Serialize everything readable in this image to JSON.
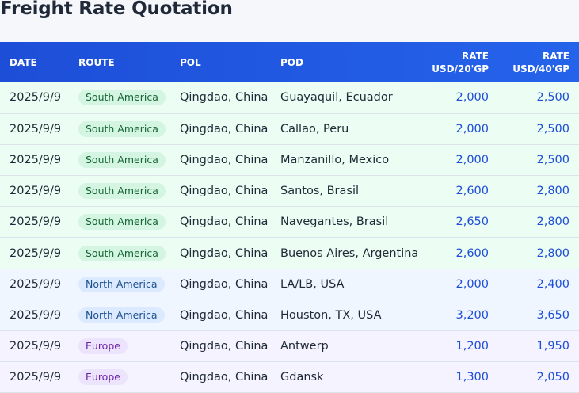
{
  "page": {
    "title": "Freight Rate Quotation"
  },
  "table": {
    "columns": {
      "date": "DATE",
      "route": "ROUTE",
      "pol": "POL",
      "pod": "POD",
      "rate20_line1": "RATE",
      "rate20_line2": "USD/20'GP",
      "rate40_line1": "RATE",
      "rate40_line2": "USD/40'GP"
    },
    "rows": [
      {
        "date": "2025/9/9",
        "route": "South America",
        "pol": "Qingdao, China",
        "pod": "Guayaquil, Ecuador",
        "rate20": "2,000",
        "rate40": "2,500"
      },
      {
        "date": "2025/9/9",
        "route": "South America",
        "pol": "Qingdao, China",
        "pod": "Callao, Peru",
        "rate20": "2,000",
        "rate40": "2,500"
      },
      {
        "date": "2025/9/9",
        "route": "South America",
        "pol": "Qingdao, China",
        "pod": "Manzanillo, Mexico",
        "rate20": "2,000",
        "rate40": "2,500"
      },
      {
        "date": "2025/9/9",
        "route": "South America",
        "pol": "Qingdao, China",
        "pod": "Santos, Brasil",
        "rate20": "2,600",
        "rate40": "2,800"
      },
      {
        "date": "2025/9/9",
        "route": "South America",
        "pol": "Qingdao, China",
        "pod": "Navegantes, Brasil",
        "rate20": "2,650",
        "rate40": "2,800"
      },
      {
        "date": "2025/9/9",
        "route": "South America",
        "pol": "Qingdao, China",
        "pod": "Buenos Aires, Argentina",
        "rate20": "2,600",
        "rate40": "2,800"
      },
      {
        "date": "2025/9/9",
        "route": "North America",
        "pol": "Qingdao, China",
        "pod": "LA/LB, USA",
        "rate20": "2,000",
        "rate40": "2,400"
      },
      {
        "date": "2025/9/9",
        "route": "North America",
        "pol": "Qingdao, China",
        "pod": "Houston, TX, USA",
        "rate20": "3,200",
        "rate40": "3,650"
      },
      {
        "date": "2025/9/9",
        "route": "Europe",
        "pol": "Qingdao, China",
        "pod": "Antwerp",
        "rate20": "1,200",
        "rate40": "1,950"
      },
      {
        "date": "2025/9/9",
        "route": "Europe",
        "pol": "Qingdao, China",
        "pod": "Gdansk",
        "rate20": "1,300",
        "rate40": "2,050"
      }
    ]
  },
  "colors": {
    "header_bg": "#1d4ed8",
    "south_america_row": "#ecfdf3",
    "north_america_row": "#eff6ff",
    "europe_row": "#f5f3ff",
    "rate_text": "#1d4ed8"
  }
}
